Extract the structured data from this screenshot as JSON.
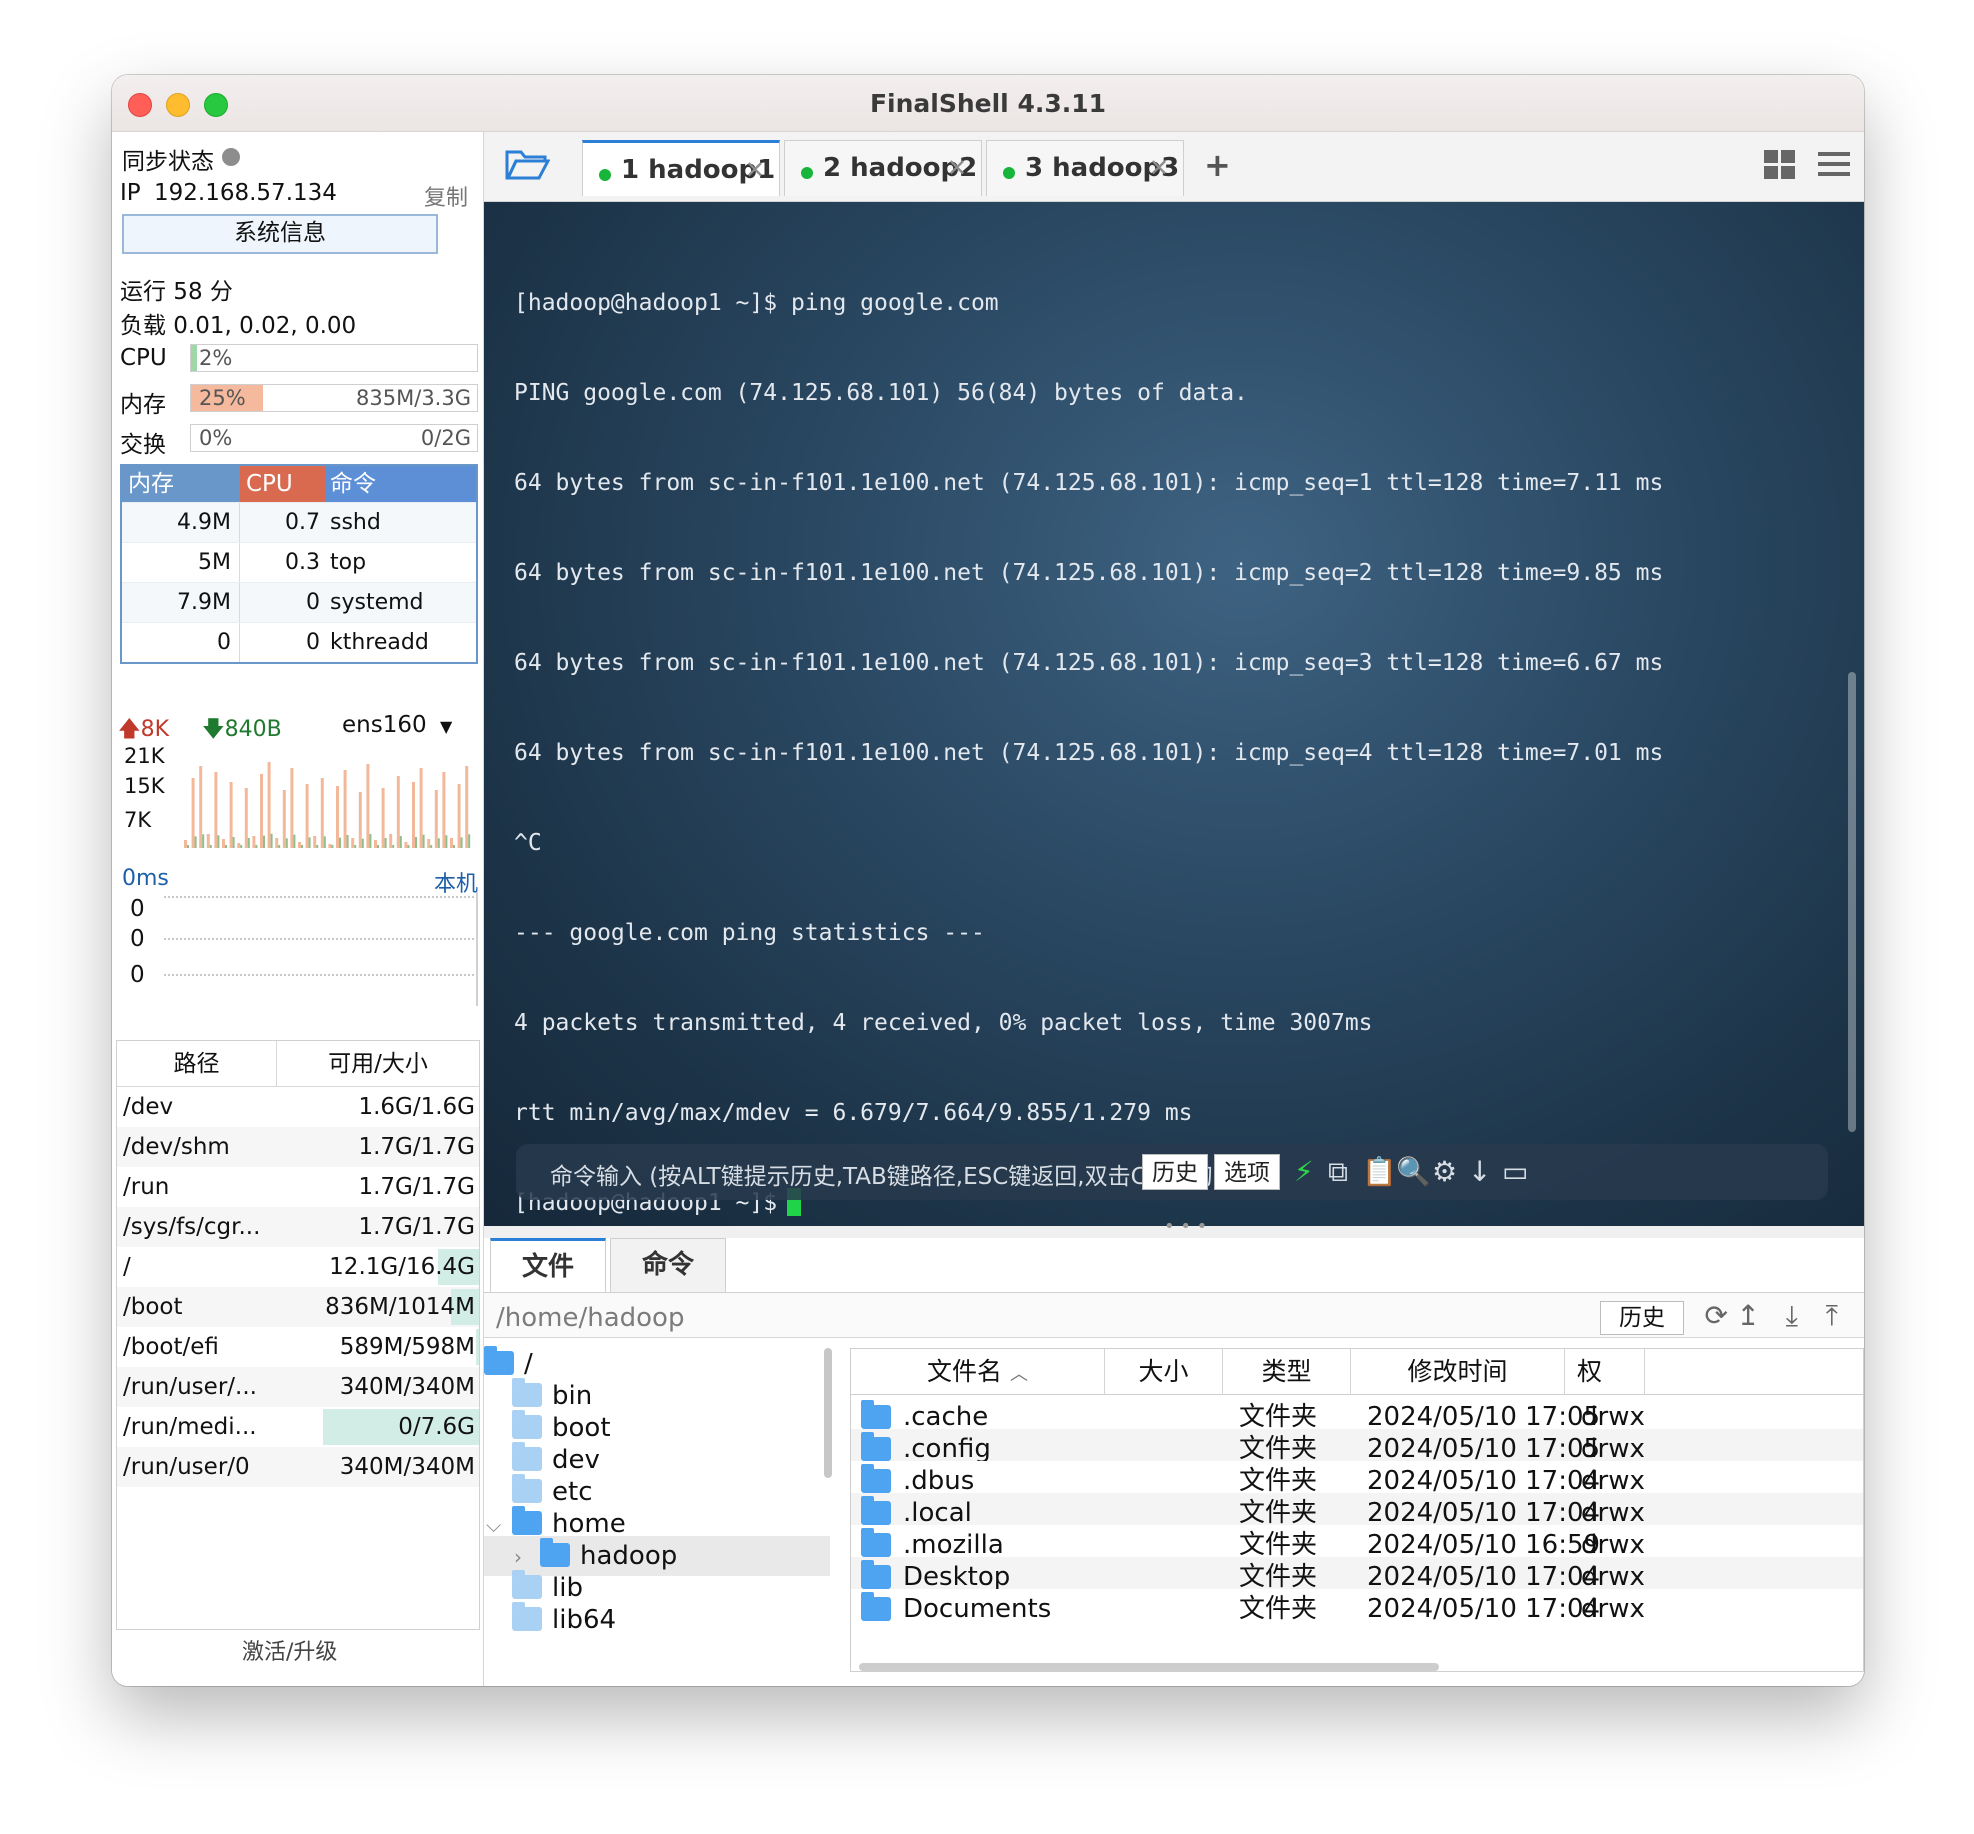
{
  "window": {
    "title": "FinalShell 4.3.11"
  },
  "sidebar": {
    "sync_label": "同步状态",
    "ip_label": "IP",
    "ip_value": "192.168.57.134",
    "copy_label": "复制",
    "sysinfo_button": "系统信息",
    "uptime": "运行 58 分",
    "load": "负载 0.01, 0.02, 0.00",
    "cpu": {
      "label": "CPU",
      "value": "2%",
      "fraction": 0.02
    },
    "mem": {
      "label": "内存",
      "value": "25%",
      "detail": "835M/3.3G",
      "fraction": 0.25
    },
    "swap": {
      "label": "交换",
      "value": "0%",
      "detail": "0/2G",
      "fraction": 0.0
    },
    "proc_headers": [
      "内存",
      "CPU",
      "命令"
    ],
    "processes": [
      {
        "mem": "4.9M",
        "cpu": "0.7",
        "cmd": "sshd"
      },
      {
        "mem": "5M",
        "cpu": "0.3",
        "cmd": "top"
      },
      {
        "mem": "7.9M",
        "cpu": "0",
        "cmd": "systemd"
      },
      {
        "mem": "0",
        "cpu": "0",
        "cmd": "kthreadd"
      }
    ],
    "net": {
      "up": "8K",
      "down": "840B",
      "interface": "ens160",
      "y_labels": [
        "21K",
        "15K",
        "7K"
      ]
    },
    "ping": {
      "latency": "0ms",
      "host": "本机",
      "rows": [
        "0",
        "0",
        "0"
      ]
    },
    "disk_headers": [
      "路径",
      "可用/大小"
    ],
    "disks": [
      {
        "path": "/dev",
        "usage": "1.6G/1.6G",
        "used": 0.0
      },
      {
        "path": "/dev/shm",
        "usage": "1.7G/1.7G",
        "used": 0.0
      },
      {
        "path": "/run",
        "usage": "1.7G/1.7G",
        "used": 0.0
      },
      {
        "path": "/sys/fs/cgr...",
        "usage": "1.7G/1.7G",
        "used": 0.0
      },
      {
        "path": "/",
        "usage": "12.1G/16.4G",
        "used": 0.26
      },
      {
        "path": "/boot",
        "usage": "836M/1014M",
        "used": 0.18
      },
      {
        "path": "/boot/efi",
        "usage": "589M/598M",
        "used": 0.02
      },
      {
        "path": "/run/user/...",
        "usage": "340M/340M",
        "used": 0.0
      },
      {
        "path": "/run/medi...",
        "usage": "0/7.6G",
        "used": 1.0
      },
      {
        "path": "/run/user/0",
        "usage": "340M/340M",
        "used": 0.0
      }
    ],
    "activate": "激活/升级"
  },
  "tabs": [
    {
      "label": "1  hadoop1",
      "active": true
    },
    {
      "label": "2  hadoop2",
      "active": false
    },
    {
      "label": "3  hadoop3",
      "active": false
    }
  ],
  "terminal": {
    "lines": [
      "[hadoop@hadoop1 ~]$ ping google.com",
      "PING google.com (74.125.68.101) 56(84) bytes of data.",
      "64 bytes from sc-in-f101.1e100.net (74.125.68.101): icmp_seq=1 ttl=128 time=7.11 ms",
      "64 bytes from sc-in-f101.1e100.net (74.125.68.101): icmp_seq=2 ttl=128 time=9.85 ms",
      "64 bytes from sc-in-f101.1e100.net (74.125.68.101): icmp_seq=3 ttl=128 time=6.67 ms",
      "64 bytes from sc-in-f101.1e100.net (74.125.68.101): icmp_seq=4 ttl=128 time=7.01 ms",
      "^C",
      "--- google.com ping statistics ---",
      "4 packets transmitted, 4 received, 0% packet loss, time 3007ms",
      "rtt min/avg/max/mdev = 6.679/7.664/9.855/1.279 ms"
    ],
    "prompt": "[hadoop@hadoop1 ~]$",
    "cmd_hint": "命令输入 (按ALT键提示历史,TAB键路径,ESC键返回,双击CTRL切:",
    "history_button": "历史",
    "options_button": "选项"
  },
  "bottom": {
    "tabs": [
      "文件",
      "命令"
    ],
    "path": "/home/hadoop",
    "history_button": "历史",
    "tree": [
      {
        "name": "/",
        "indent": 0,
        "folder": "dark"
      },
      {
        "name": "bin",
        "indent": 1,
        "folder": "light"
      },
      {
        "name": "boot",
        "indent": 1,
        "folder": "light"
      },
      {
        "name": "dev",
        "indent": 1,
        "folder": "light"
      },
      {
        "name": "etc",
        "indent": 1,
        "folder": "light"
      },
      {
        "name": "home",
        "indent": 1,
        "folder": "dark",
        "expanded": true
      },
      {
        "name": "hadoop",
        "indent": 2,
        "folder": "dark",
        "selected": true
      },
      {
        "name": "lib",
        "indent": 1,
        "folder": "light"
      },
      {
        "name": "lib64",
        "indent": 1,
        "folder": "light"
      }
    ],
    "file_headers": [
      "文件名",
      "大小",
      "类型",
      "修改时间",
      "权"
    ],
    "files": [
      {
        "name": ".cache",
        "size": "",
        "type": "文件夹",
        "mtime": "2024/05/10 17:05",
        "perm": "drwx"
      },
      {
        "name": ".config",
        "size": "",
        "type": "文件夹",
        "mtime": "2024/05/10 17:05",
        "perm": "drwx"
      },
      {
        "name": ".dbus",
        "size": "",
        "type": "文件夹",
        "mtime": "2024/05/10 17:04",
        "perm": "drwx"
      },
      {
        "name": ".local",
        "size": "",
        "type": "文件夹",
        "mtime": "2024/05/10 17:04",
        "perm": "drwx"
      },
      {
        "name": ".mozilla",
        "size": "",
        "type": "文件夹",
        "mtime": "2024/05/10 16:59",
        "perm": "drwx"
      },
      {
        "name": "Desktop",
        "size": "",
        "type": "文件夹",
        "mtime": "2024/05/10 17:04",
        "perm": "drwx"
      },
      {
        "name": "Documents",
        "size": "",
        "type": "文件夹",
        "mtime": "2024/05/10 17:04",
        "perm": "drwx"
      }
    ]
  },
  "colors": {
    "tab_accent": "#2b7fd6",
    "status_dot": "#17b53a",
    "cursor": "#1fd34a",
    "mem_fill": "#f5b99d",
    "cpu_fill": "#9fd7a9",
    "proc_mem_header": "#6a97c9",
    "proc_cpu_header": "#d9694f",
    "proc_cmd_header": "#5c8fd6",
    "net_up": "#c0392b",
    "net_down": "#1e7a2e"
  }
}
